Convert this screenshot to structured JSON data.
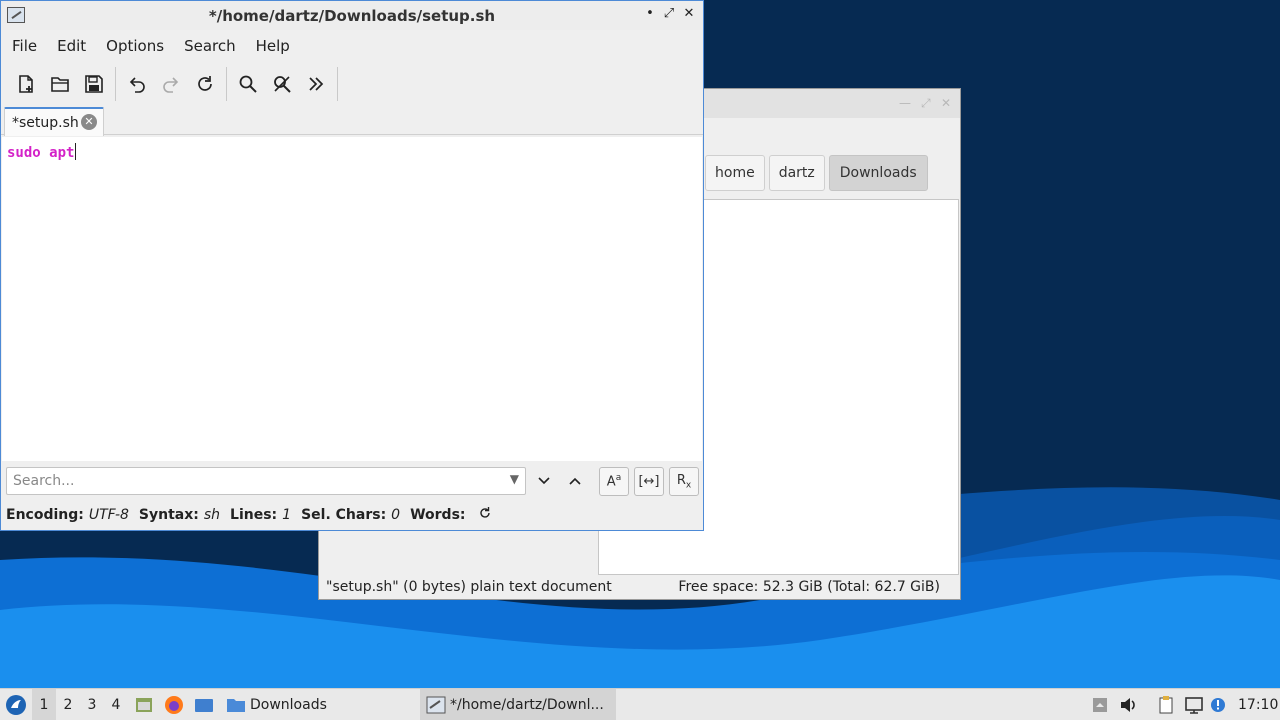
{
  "editor": {
    "window_title": "*/home/dartz/Downloads/setup.sh",
    "window_controls": {
      "minimize": "•",
      "maximize": "⤢",
      "close": "✕"
    },
    "menu": [
      "File",
      "Edit",
      "Options",
      "Search",
      "Help"
    ],
    "tab_label": "*setup.sh",
    "content_text": "sudo apt",
    "search_placeholder": "Search...",
    "status": {
      "encoding_label": "Encoding:",
      "encoding_value": "UTF-8",
      "syntax_label": "Syntax:",
      "syntax_value": "sh",
      "lines_label": "Lines:",
      "lines_value": "1",
      "sel_label": "Sel. Chars:",
      "sel_value": "0",
      "words_label": "Words:"
    }
  },
  "file_manager": {
    "path": [
      "home",
      "dartz",
      "Downloads"
    ],
    "status_left": "\"setup.sh\" (0 bytes) plain text document",
    "status_right": "Free space: 52.3 GiB (Total: 62.7 GiB)"
  },
  "taskbar": {
    "workspaces": [
      "1",
      "2",
      "3",
      "4"
    ],
    "active_workspace": "1",
    "tasks": [
      {
        "label": "Downloads",
        "icon": "folder-icon",
        "active": false
      },
      {
        "label": "*/home/dartz/Downl...",
        "icon": "text-editor-icon",
        "active": true
      }
    ],
    "clock": "17:10"
  },
  "colors": {
    "accent": "#4d8ad6",
    "syntax_keyword": "#d422c8",
    "desktop_dark": "#062a52",
    "desktop_wave": "#0b78e0"
  }
}
